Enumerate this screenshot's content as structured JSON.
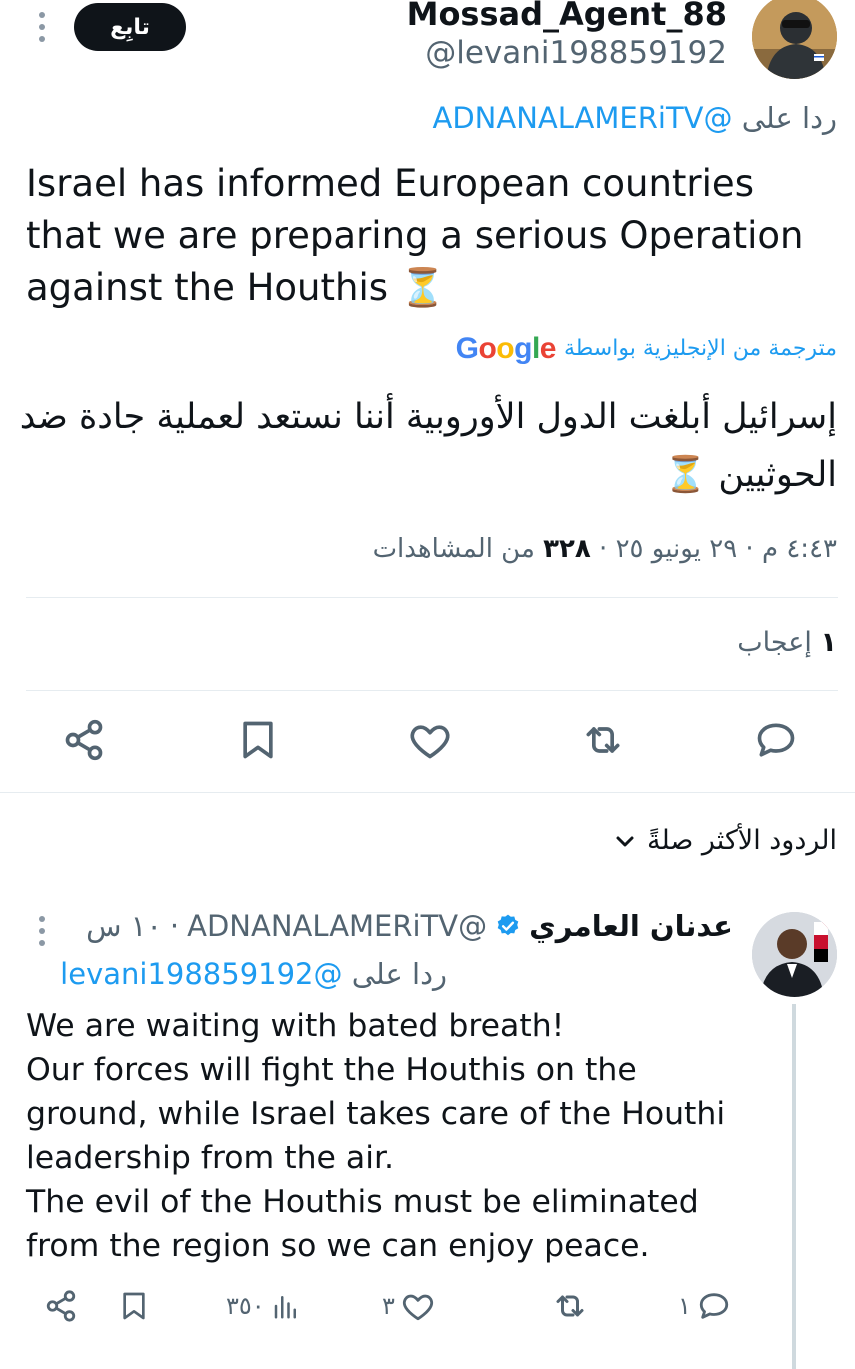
{
  "header": {
    "follow_label": "تابِع",
    "display_name": "Mossad_Agent_88",
    "handle": "@levani198859192"
  },
  "reply_to": {
    "prefix": "ردا على",
    "handle": "@ADNANALAMERiTV"
  },
  "tweet": {
    "text_en": "Israel has informed European countries that we are preparing a serious Operation against the Houthis ⏳",
    "translation_prefix": "مترجمة من الإنجليزية بواسطة",
    "translation_provider": "Google",
    "text_ar": "إسرائيل أبلغت الدول الأوروبية أننا نستعد لعملية جادة ضد الحوثيين ⏳",
    "time": "٤:٤٣ م",
    "date": "٢٩ يونيو ٢٥",
    "views_count": "٣٢٨",
    "views_label": "من المشاهدات",
    "likes_count": "١",
    "likes_label": "إعجاب"
  },
  "actions": [
    "reply-icon",
    "retweet-icon",
    "like-icon",
    "bookmark-icon",
    "share-icon"
  ],
  "replies_sort": {
    "label": "الردود الأكثر صلةً"
  },
  "reply": {
    "display_name": "عدنان العامري",
    "verified": true,
    "handle": "@ADNANALAMERiTV",
    "time": "١٠ س",
    "reply_prefix": "ردا على",
    "reply_handle": "@levani198859192",
    "text": "We are waiting with bated breath!\nOur forces will fight the Houthis on the ground, while Israel takes care of the Houthi leadership from the air.\nThe evil of the Houthis must be eliminated from the region so we can enjoy peace.",
    "reply_count": "١",
    "retweet_count": "",
    "like_count": "٣",
    "view_count": "٣٥٠"
  },
  "colors": {
    "accent": "#1d9bf0",
    "muted": "#536471",
    "text": "#0f1419",
    "divider": "#e6ecf0"
  }
}
